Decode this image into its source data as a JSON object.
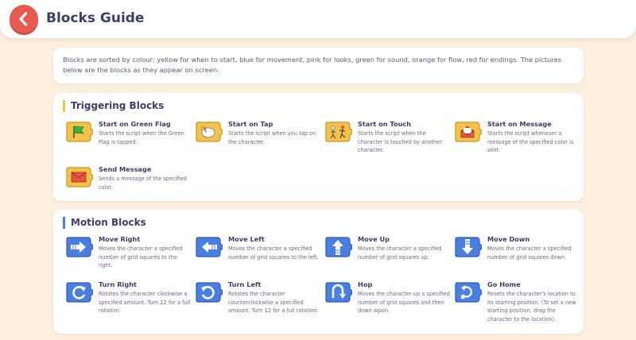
{
  "header": {
    "title": "Blocks Guide",
    "back_icon": "chevron-left-icon"
  },
  "intro": "Blocks are sorted by colour: yellow for when to start, blue for movement, pink for looks, green for sound, orange for flow, red for endings. The pictures below are the blocks as they appear on screen.",
  "colors": {
    "trigger": "#f2c14e",
    "motion": "#4a7fe0",
    "back_button": "#e85a4f"
  },
  "sections": [
    {
      "title": "Triggering Blocks",
      "blocks": [
        {
          "name": "Start on Green Flag",
          "desc": "Starts the script when the Green Flag is tapped.",
          "icon": "green-flag-icon"
        },
        {
          "name": "Start on Tap",
          "desc": "Starts the script when you tap on the character.",
          "icon": "tap-hand-icon"
        },
        {
          "name": "Start on Touch",
          "desc": "Starts the script when the character is touched by another character.",
          "icon": "touch-characters-icon"
        },
        {
          "name": "Start on Message",
          "desc": "Starts the script whenever a message of the specified color is sent.",
          "icon": "open-envelope-icon"
        },
        {
          "name": "Send Message",
          "desc": "Sends a message of the specified color.",
          "icon": "envelope-icon"
        }
      ]
    },
    {
      "title": "Motion Blocks",
      "blocks": [
        {
          "name": "Move Right",
          "desc": "Moves the character a specified number of grid squares to the right.",
          "icon": "arrow-right-icon"
        },
        {
          "name": "Move Left",
          "desc": "Moves the character a specified number of grid squares to the left.",
          "icon": "arrow-left-icon"
        },
        {
          "name": "Move Up",
          "desc": "Moves the character a specified number of grid squares up.",
          "icon": "arrow-up-icon"
        },
        {
          "name": "Move Down",
          "desc": "Moves the character a specified number of grid squares down.",
          "icon": "arrow-down-icon"
        },
        {
          "name": "Turn Right",
          "desc": "Rotates the character clockwise a specified amount. Turn 12 for a full rotation.",
          "icon": "rotate-clockwise-icon"
        },
        {
          "name": "Turn Left",
          "desc": "Rotates the character counterclockwise a specified amount. Turn 12 for a full rotation.",
          "icon": "rotate-counterclockwise-icon"
        },
        {
          "name": "Hop",
          "desc": "Moves the character up a specified number of grid squares and then down again.",
          "icon": "hop-icon"
        },
        {
          "name": "Go Home",
          "desc": "Resets the character's location to its starting position. (To set a new starting position, drag the character to the location).",
          "icon": "go-home-icon"
        }
      ]
    }
  ]
}
